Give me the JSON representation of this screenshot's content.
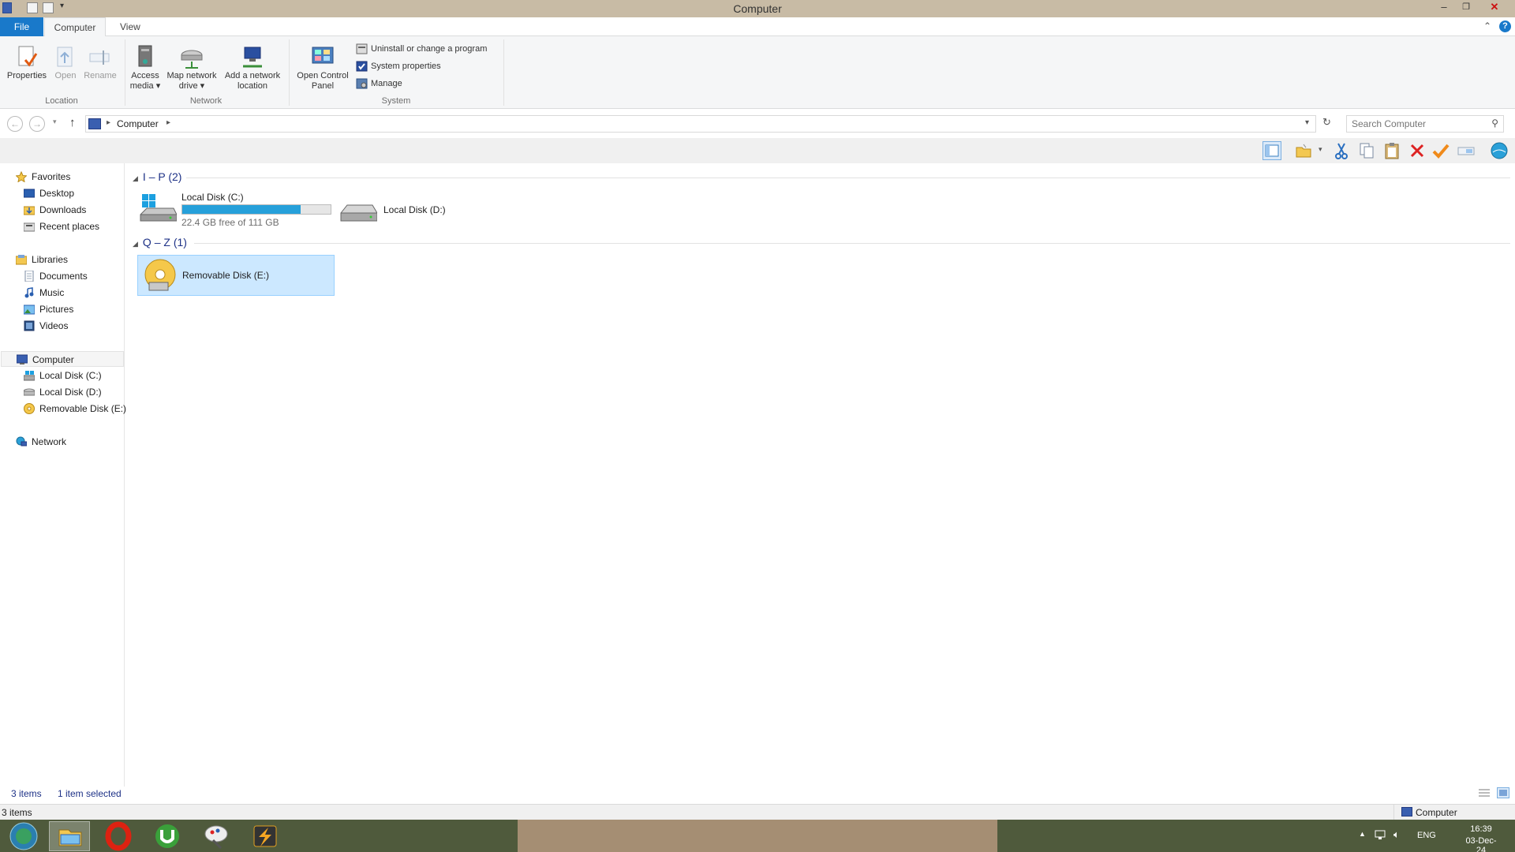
{
  "window": {
    "title": "Computer",
    "controls": {
      "minimize": "–",
      "restore": "❐",
      "close": "✕"
    }
  },
  "ribbon": {
    "tabs": [
      {
        "label": "File"
      },
      {
        "label": "Computer"
      },
      {
        "label": "View"
      }
    ],
    "groups": {
      "location": {
        "label": "Location",
        "properties": "Properties",
        "open": "Open",
        "rename": "Rename"
      },
      "network": {
        "label": "Network",
        "access_media_1": "Access",
        "access_media_2": "media",
        "map_drive_1": "Map network",
        "map_drive_2": "drive",
        "add_location_1": "Add a network",
        "add_location_2": "location"
      },
      "system": {
        "label": "System",
        "control_panel_1": "Open Control",
        "control_panel_2": "Panel",
        "uninstall": "Uninstall or change a program",
        "system_properties": "System properties",
        "manage": "Manage"
      }
    }
  },
  "address": {
    "path": "Computer",
    "search_placeholder": "Search Computer"
  },
  "nav": {
    "favorites": "Favorites",
    "desktop": "Desktop",
    "downloads": "Downloads",
    "recent": "Recent places",
    "libraries": "Libraries",
    "documents": "Documents",
    "music": "Music",
    "pictures": "Pictures",
    "videos": "Videos",
    "computer": "Computer",
    "local_c": "Local Disk (C:)",
    "local_d": "Local Disk (D:)",
    "removable_e": "Removable Disk (E:)",
    "network": "Network"
  },
  "content": {
    "group1": "I – P (2)",
    "group2": "Q – Z (1)",
    "drive_c": {
      "name": "Local Disk (C:)",
      "free": "22.4 GB free of 111 GB",
      "used_fraction": 0.8
    },
    "drive_d": {
      "name": "Local Disk (D:)"
    },
    "drive_e": {
      "name": "Removable Disk (E:)"
    }
  },
  "status": {
    "items": "3 items",
    "selected": "1 item selected",
    "detail_left": "3 items",
    "detail_right": "Computer"
  },
  "taskbar": {
    "language": "ENG",
    "time": "16:39",
    "date": "03-Dec-24"
  },
  "colors": {
    "accent": "#1979ca",
    "selection": "#cce8ff",
    "usage_bar": "#26a0da"
  }
}
